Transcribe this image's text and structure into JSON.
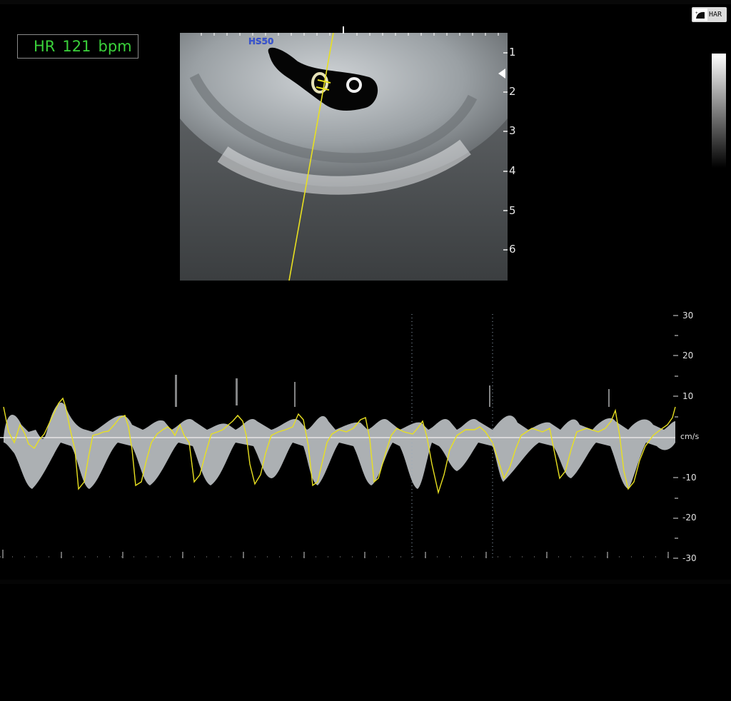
{
  "hr": {
    "label": "HR",
    "value": "121",
    "unit": "bpm"
  },
  "preset": {
    "label": "HS50"
  },
  "har_button": {
    "label": "HAR"
  },
  "depth_scale": [
    "1",
    "2",
    "3",
    "4",
    "5",
    "6"
  ],
  "velocity_scale": [
    "30",
    "20",
    "10",
    "-10",
    "-20",
    "-30"
  ],
  "velocity_unit": "cm/s",
  "colors": {
    "hr_text": "#3ad13a",
    "trace": "#e8e020",
    "baseline": "#e6e6e6",
    "preset": "#3c5ad6"
  },
  "icons": [
    "probe-icon",
    "focus-marker-icon"
  ]
}
